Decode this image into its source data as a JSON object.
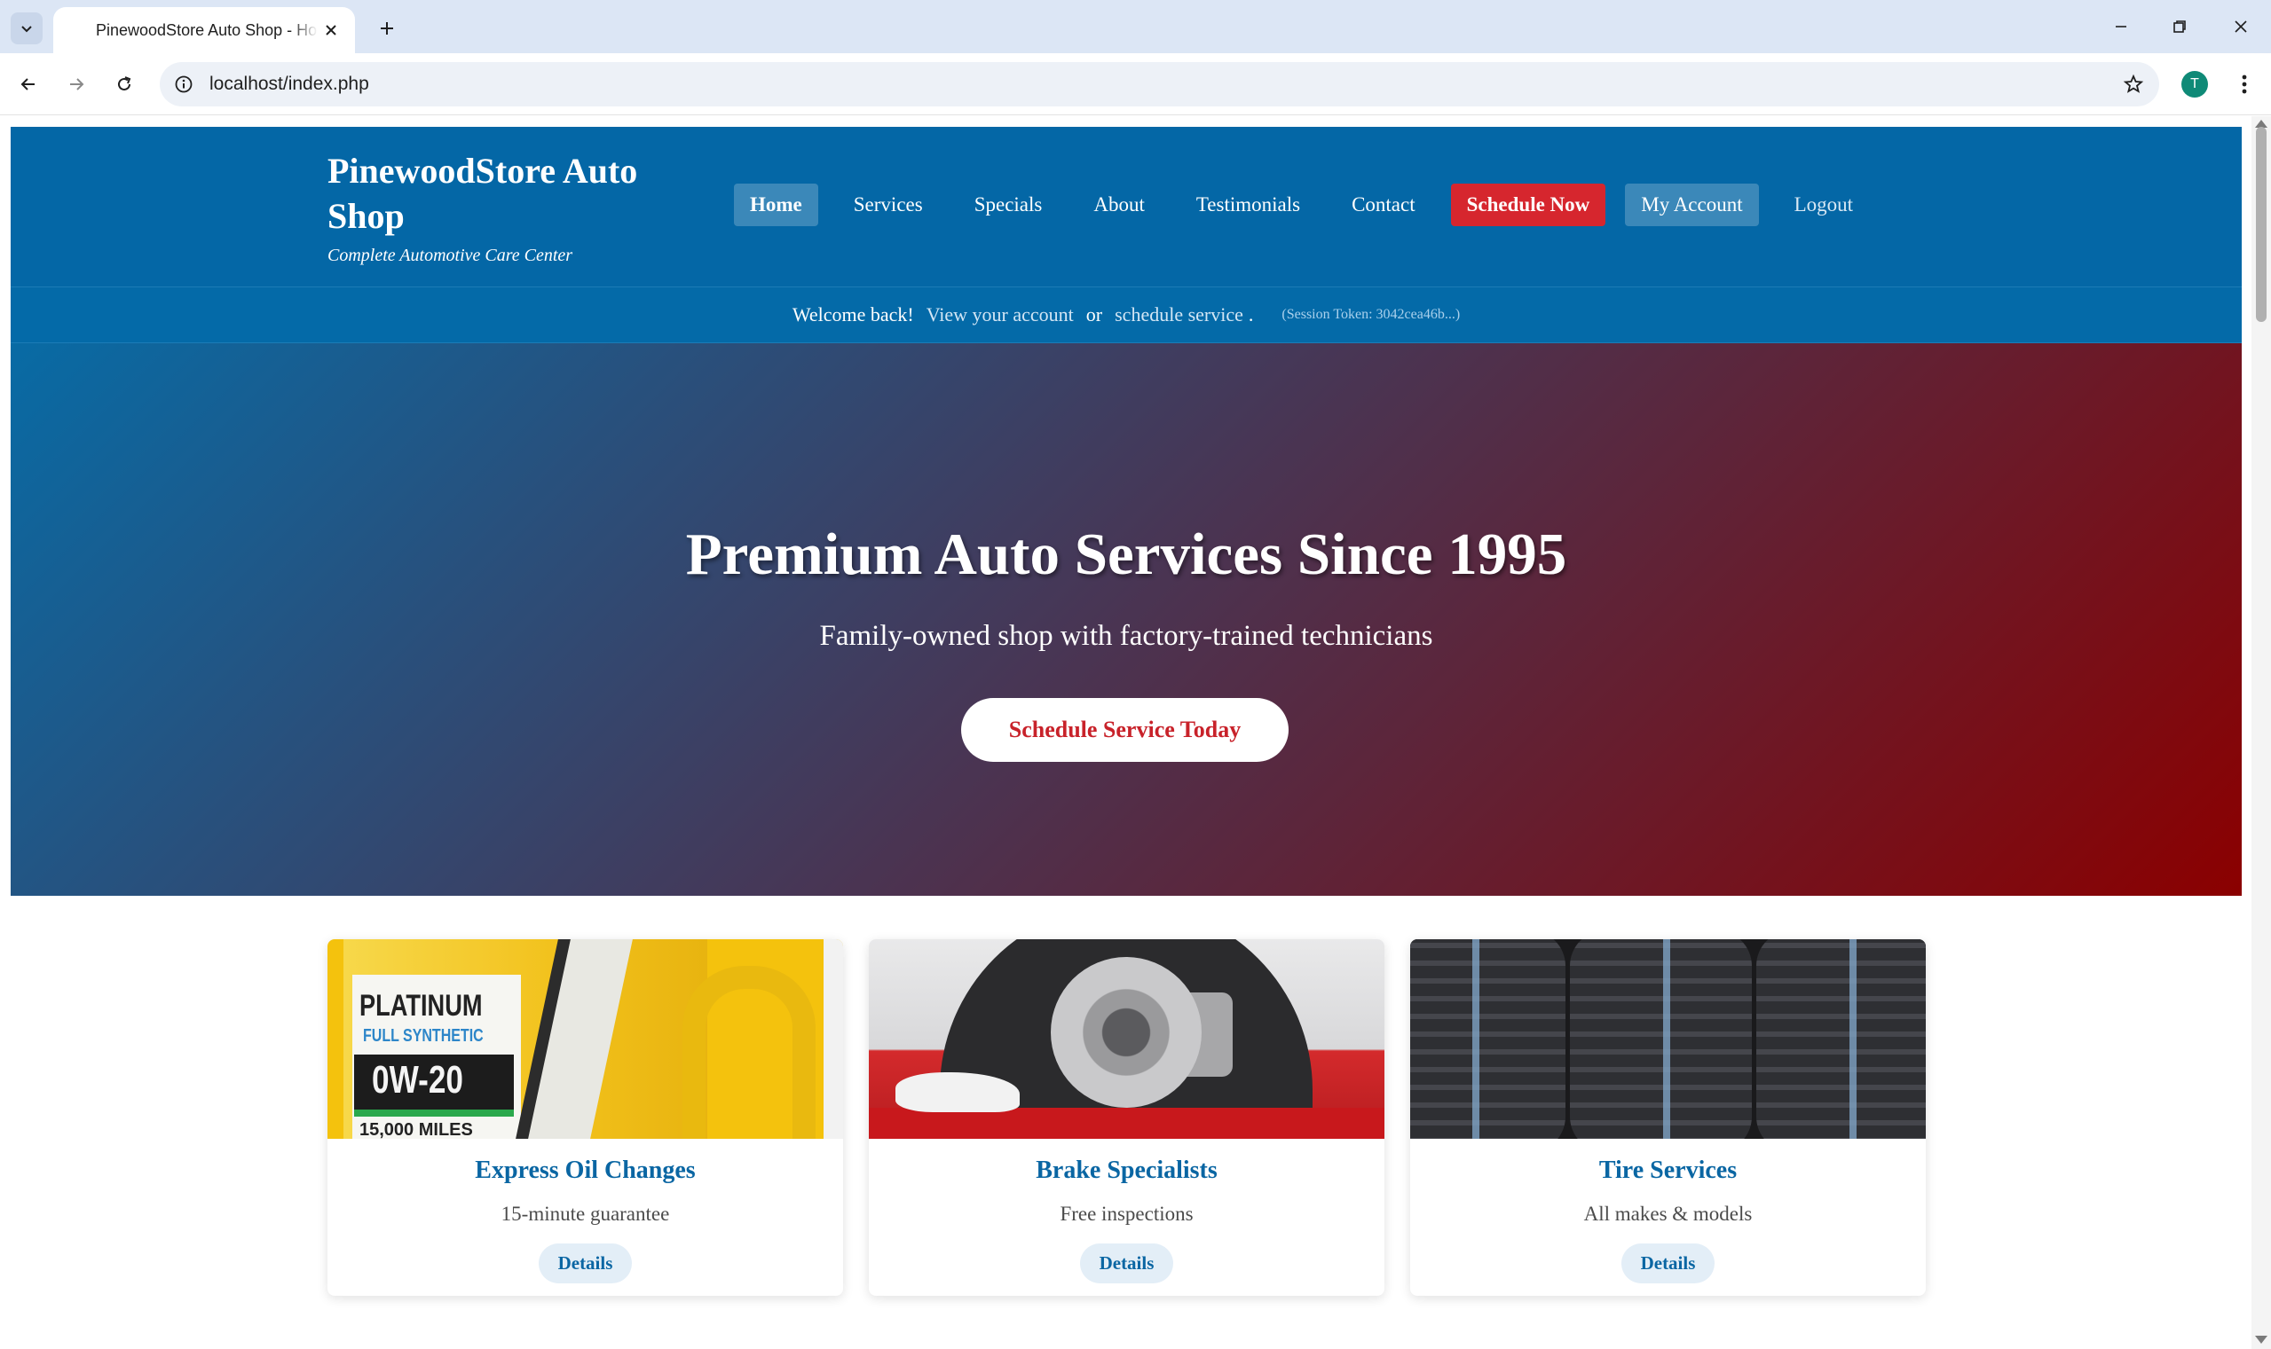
{
  "browser": {
    "tab_title": "PinewoodStore Auto Shop - Home",
    "url": "localhost/index.php",
    "profile_initial": "T"
  },
  "site": {
    "brand_name": "PinewoodStore Auto Shop",
    "tagline": "Complete Automotive Care Center",
    "nav": [
      {
        "label": "Home"
      },
      {
        "label": "Services"
      },
      {
        "label": "Specials"
      },
      {
        "label": "About"
      },
      {
        "label": "Testimonials"
      },
      {
        "label": "Contact"
      },
      {
        "label": "Schedule Now"
      },
      {
        "label": "My Account"
      },
      {
        "label": "Logout"
      }
    ],
    "welcome": {
      "greeting": "Welcome back!",
      "account_link": "View your account",
      "or": "or",
      "schedule_link": "schedule service",
      "period": ".",
      "token": "(Session Token: 3042cea46b...)"
    },
    "hero": {
      "title": "Premium Auto Services Since 1995",
      "subtitle": "Family-owned shop with factory-trained technicians",
      "cta": "Schedule Service Today"
    },
    "cards": [
      {
        "title": "Express Oil Changes",
        "desc": "15-minute guarantee",
        "button": "Details",
        "image": "motor-oil-bottle",
        "image_text": {
          "brand": "PLATINUM",
          "line": "FULL SYNTHETIC",
          "grade": "0W-20",
          "miles": "15,000 MILES"
        }
      },
      {
        "title": "Brake Specialists",
        "desc": "Free inspections",
        "button": "Details",
        "image": "brake-rotor"
      },
      {
        "title": "Tire Services",
        "desc": "All makes & models",
        "button": "Details",
        "image": "tires"
      }
    ]
  },
  "colors": {
    "header_blue": "#0467a6",
    "cta_red": "#d6262e",
    "hero_start": "#086ba5",
    "hero_end": "#8b0000",
    "card_title": "#0a66a3"
  }
}
